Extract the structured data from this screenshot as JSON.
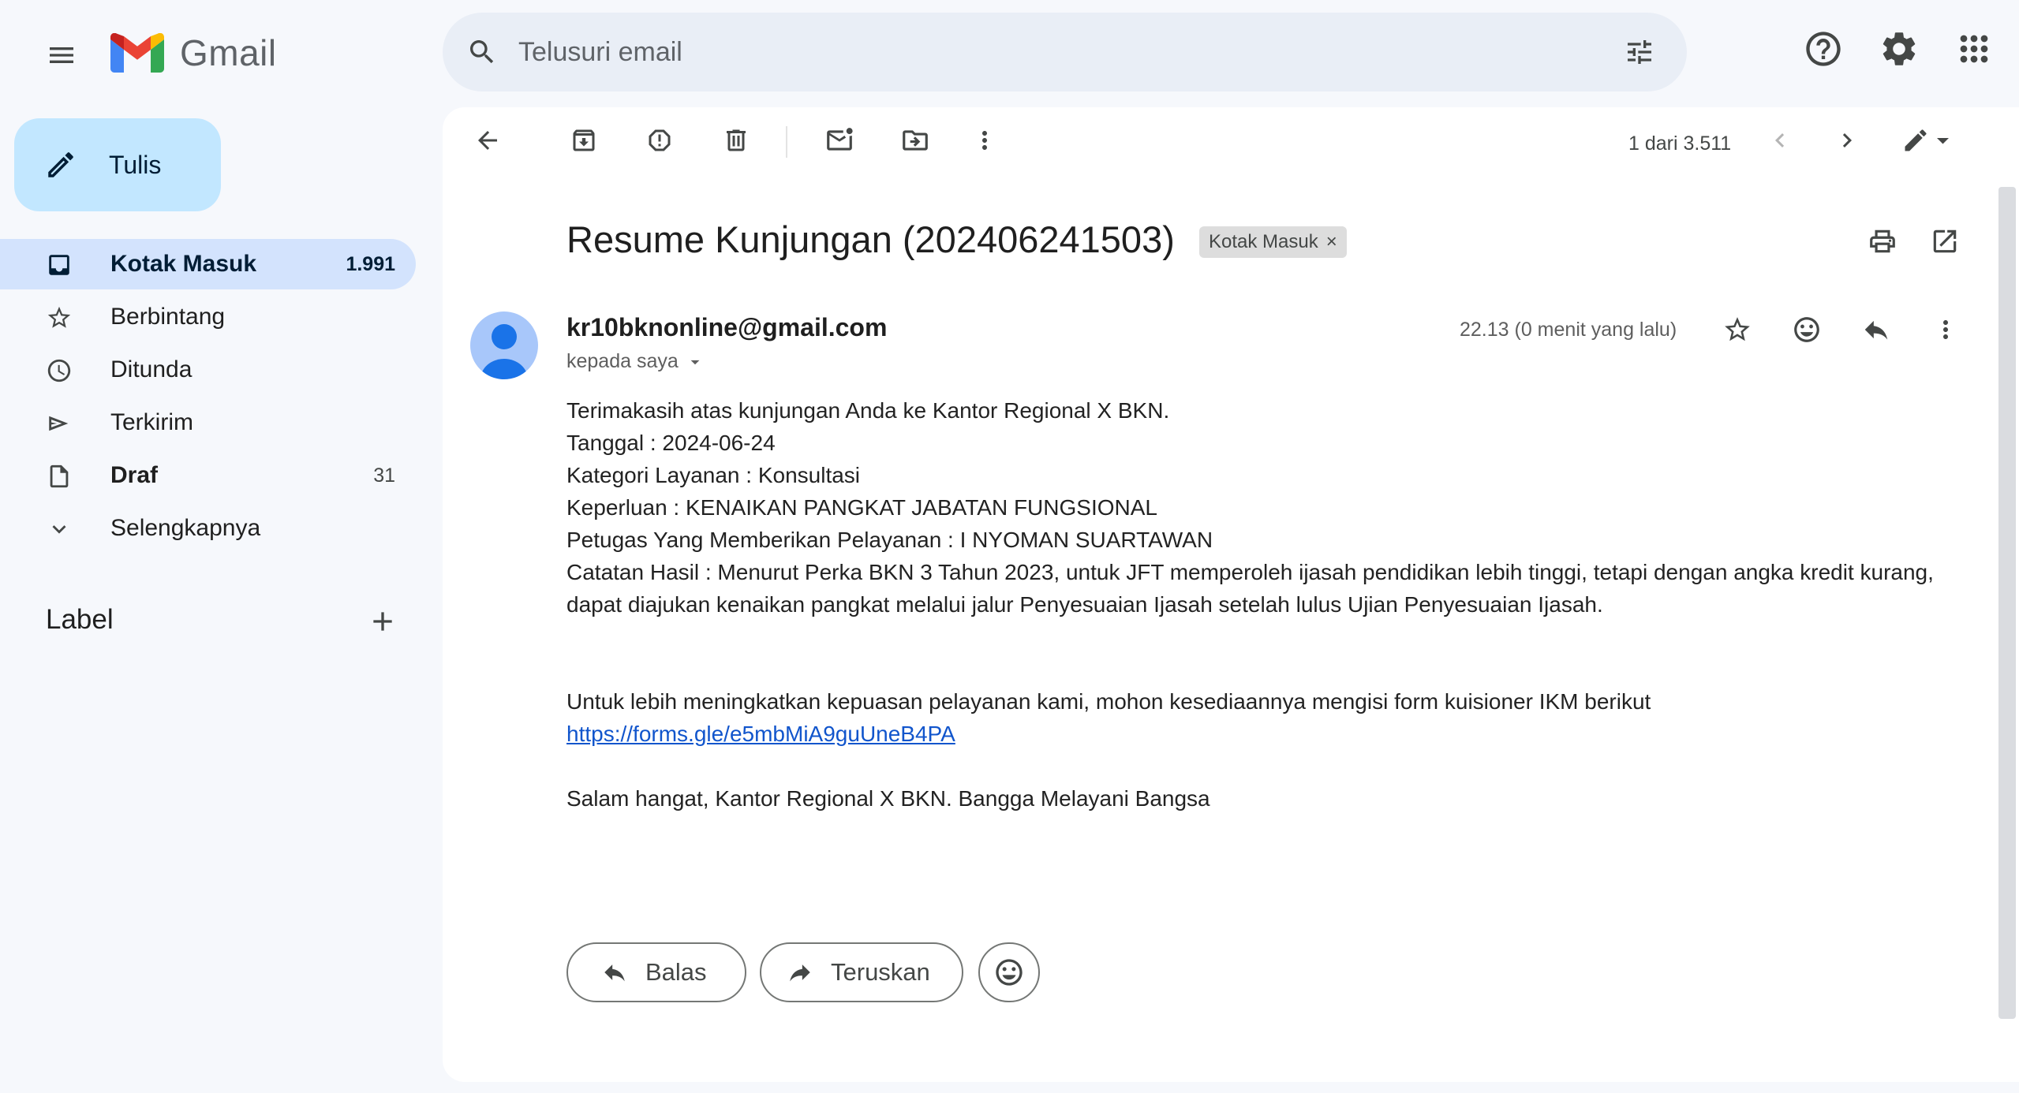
{
  "app": {
    "name": "Gmail"
  },
  "search": {
    "placeholder": "Telusuri email"
  },
  "compose": {
    "label": "Tulis"
  },
  "sidebar": {
    "items": [
      {
        "label": "Kotak Masuk",
        "count": "1.991",
        "icon": "inbox-icon"
      },
      {
        "label": "Berbintang",
        "count": "",
        "icon": "star-icon"
      },
      {
        "label": "Ditunda",
        "count": "",
        "icon": "clock-icon"
      },
      {
        "label": "Terkirim",
        "count": "",
        "icon": "send-icon"
      },
      {
        "label": "Draf",
        "count": "31",
        "icon": "draft-icon"
      },
      {
        "label": "Selengkapnya",
        "count": "",
        "icon": "chevron-down-icon"
      }
    ],
    "labels_heading": "Label"
  },
  "toolbar": {
    "pager": "1 dari 3.511"
  },
  "email": {
    "subject": "Resume Kunjungan (202406241503)",
    "label_chip": "Kotak Masuk",
    "sender": "kr10bknonline@gmail.com",
    "recipient": "kepada saya",
    "time": "22.13 (0 menit yang lalu)",
    "body": {
      "line1": "Terimakasih atas kunjungan Anda ke Kantor Regional X BKN.",
      "line2": "Tanggal : 2024-06-24",
      "line3": "Kategori Layanan : Konsultasi",
      "line4": "Keperluan : KENAIKAN PANGKAT JABATAN FUNGSIONAL",
      "line5": "Petugas Yang Memberikan Pelayanan : I NYOMAN SUARTAWAN",
      "line6": "Catatan Hasil : Menurut Perka BKN 3 Tahun 2023, untuk JFT memperoleh ijasah pendidikan lebih tinggi, tetapi  dengan angka kredit kurang, dapat diajukan kenaikan pangkat melalui jalur Penyesuaian Ijasah setelah lulus Ujian Penyesuaian Ijasah.",
      "line7": "Untuk lebih meningkatkan kepuasan pelayanan kami, mohon kesediaannya mengisi form kuisioner IKM berikut",
      "link": "https://forms.gle/e5mbMiA9guUneB4PA",
      "closing": "Salam hangat, Kantor Regional X BKN. Bangga Melayani Bangsa"
    }
  },
  "actions": {
    "reply": "Balas",
    "forward": "Teruskan"
  },
  "colors": {
    "compose_bg": "#c2e7ff",
    "active_nav_bg": "#d3e3fd",
    "search_bg": "#e9eef6",
    "link": "#1155cc"
  }
}
